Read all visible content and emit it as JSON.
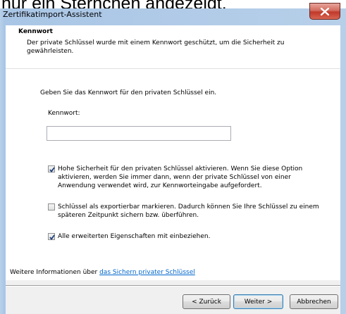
{
  "background_caption": "nur ein Sternchen angezeigt.",
  "window": {
    "title": "Zertifikatimport-Assistent"
  },
  "header": {
    "title": "Kennwort",
    "description": "Der private Schlüssel wurde mit einem Kennwort geschützt, um die Sicherheit zu gewährleisten."
  },
  "form": {
    "prompt": "Geben Sie das Kennwort für den privaten Schlüssel ein.",
    "password_label": "Kennwort:",
    "password_value": ""
  },
  "options": [
    {
      "checked": true,
      "label": "Hohe Sicherheit für den privaten Schlüssel aktivieren. Wenn Sie diese Option aktivieren, werden Sie immer dann, wenn der private Schlüssel von einer Anwendung verwendet wird, zur Kennworteingabe aufgefordert."
    },
    {
      "checked": false,
      "label": "Schlüssel als exportierbar markieren. Dadurch können Sie Ihre Schlüssel zu einem späteren Zeitpunkt sichern bzw. überführen."
    },
    {
      "checked": true,
      "label": "Alle erweiterten Eigenschaften mit einbeziehen."
    }
  ],
  "footer": {
    "more_info_prefix": "Weitere Informationen über ",
    "more_info_link": "das Sichern privater Schlüssel"
  },
  "buttons": {
    "back": "< Zurück",
    "next": "Weiter >",
    "cancel": "Abbrechen"
  },
  "icons": {
    "close": "close-icon",
    "check": "checkmark-icon"
  },
  "colors": {
    "link": "#0066cc",
    "frame": "#b9d1ea",
    "close_button": "#c0392b"
  }
}
